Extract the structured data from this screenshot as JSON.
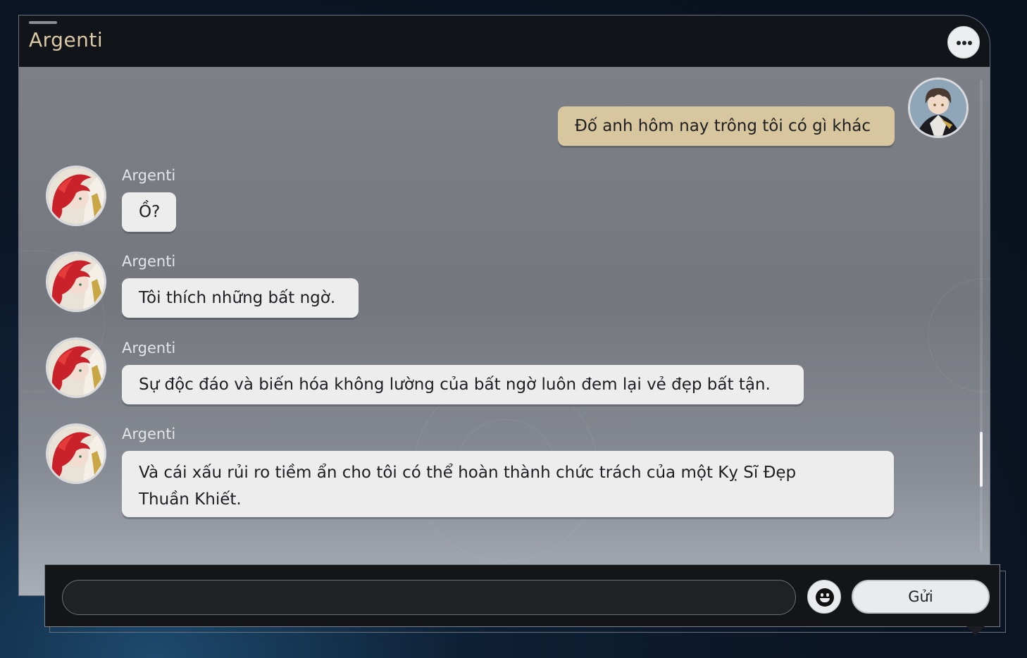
{
  "header": {
    "title": "Argenti",
    "more_icon": "ellipsis-icon"
  },
  "messages": [
    {
      "from": "me",
      "text": "Đố anh hôm nay trông tôi có gì khác"
    },
    {
      "from": "Argenti",
      "sender": "Argenti",
      "text": "Ồ?"
    },
    {
      "from": "Argenti",
      "sender": "Argenti",
      "text": "Tôi thích những bất ngờ."
    },
    {
      "from": "Argenti",
      "sender": "Argenti",
      "text": "Sự độc đáo và biến hóa không lường của bất ngờ luôn đem lại vẻ đẹp bất tận."
    },
    {
      "from": "Argenti",
      "sender": "Argenti",
      "text_line1": "Và cái xấu rủi ro tiềm ẩn cho tôi có thể hoàn thành chức trách của một Kỵ Sĩ Đẹp",
      "text_line2": "Thuần Khiết."
    }
  ],
  "composer": {
    "value": "",
    "send_label": "Gửi",
    "emoji_icon": "smiley-icon"
  },
  "colors": {
    "accent_gold": "#dac9a4",
    "my_bubble": "#d7c69e",
    "their_bubble": "#ededee"
  }
}
